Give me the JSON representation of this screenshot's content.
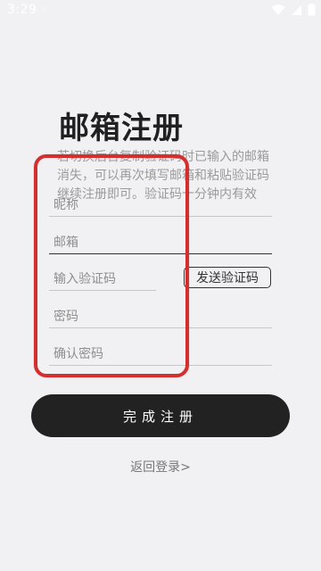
{
  "status_bar": {
    "time": "3:29",
    "extra": "··"
  },
  "page": {
    "title": "邮箱注册",
    "tip": "若切换后台复制验证码时已输入的邮箱消失，可以再次填写邮箱和粘贴验证码继续注册即可。验证码十分钟内有效"
  },
  "form": {
    "nickname_placeholder": "昵称",
    "email_placeholder": "邮箱",
    "code_placeholder": "输入验证码",
    "send_code_label": "发送验证码",
    "password_placeholder": "密码",
    "confirm_password_placeholder": "确认密码",
    "submit_label": "完成注册"
  },
  "footer": {
    "back_to_login": "返回登录>"
  },
  "colors": {
    "background": "#f1f1f3",
    "button": "#222222",
    "annotation": "#d32f2f"
  },
  "icons": [
    "wifi-icon",
    "signal-icon",
    "battery-icon"
  ]
}
